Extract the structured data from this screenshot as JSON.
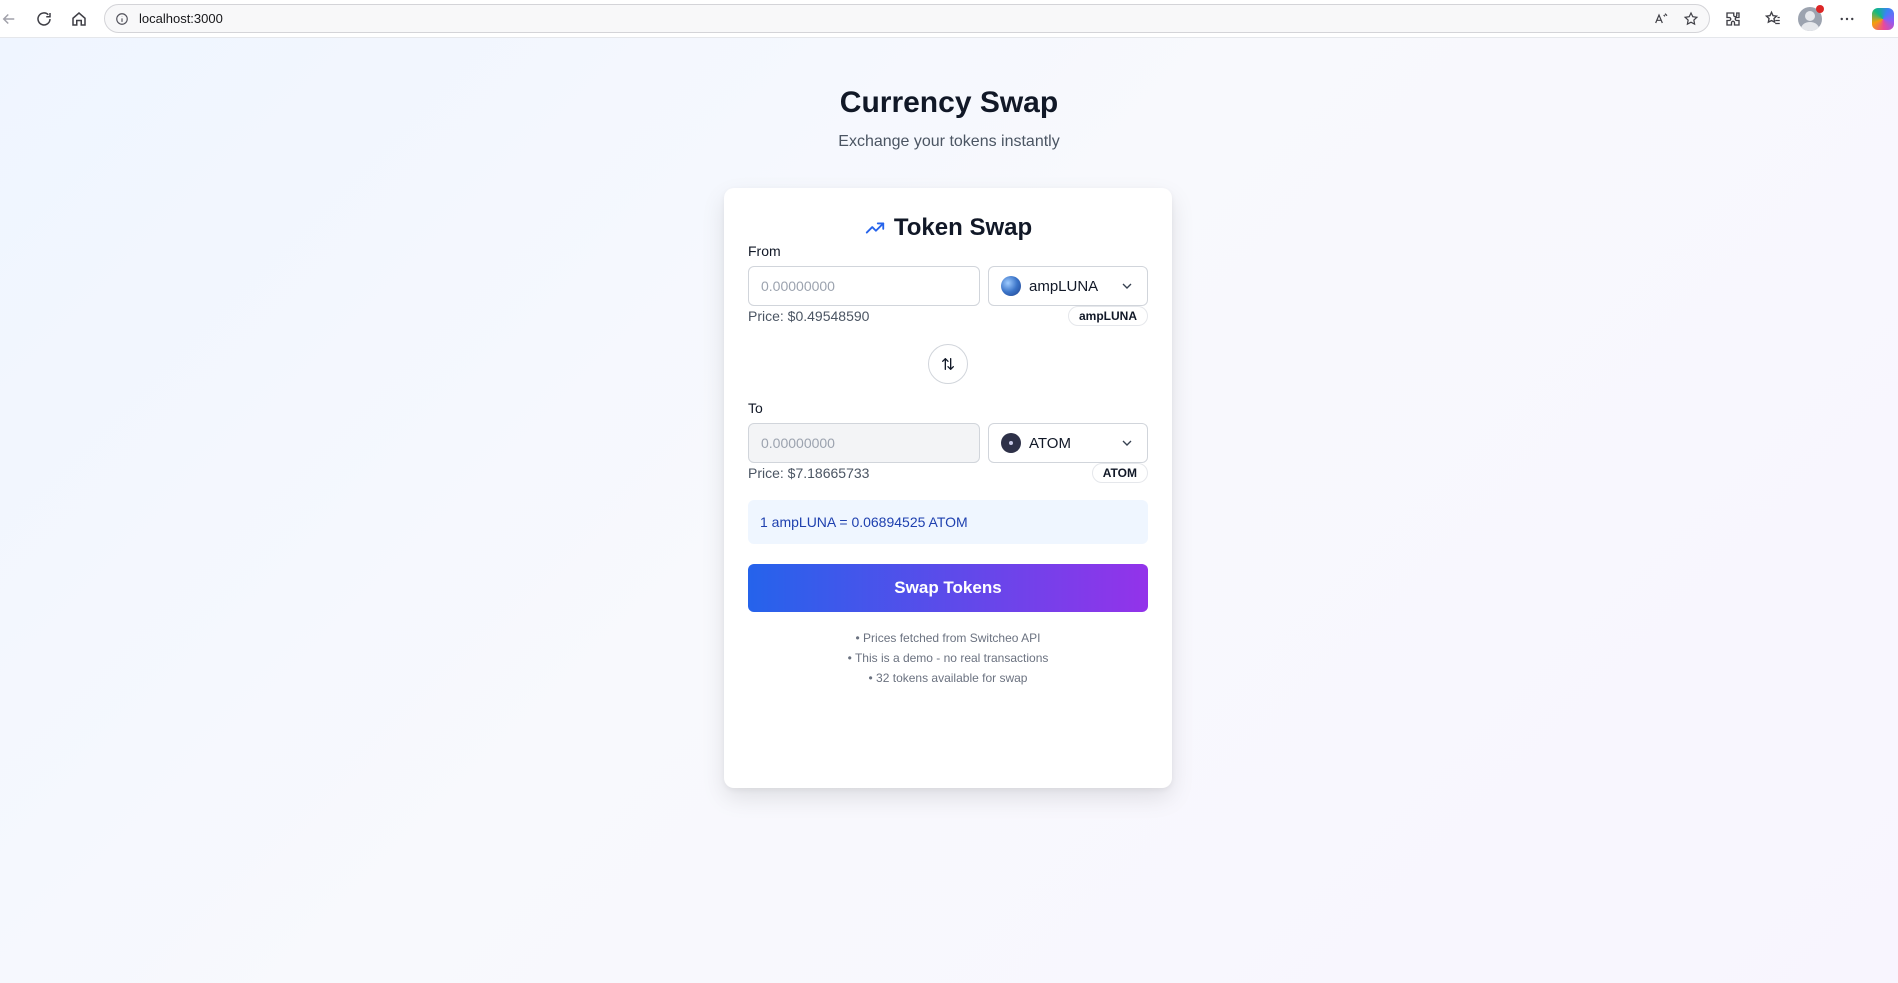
{
  "browser": {
    "url": "localhost:3000"
  },
  "page": {
    "title": "Currency Swap",
    "subtitle": "Exchange your tokens instantly"
  },
  "card": {
    "title": "Token Swap",
    "from": {
      "label": "From",
      "amount_placeholder": "0.00000000",
      "amount_value": "",
      "token": "ampLUNA",
      "price": "Price: $0.49548590",
      "badge": "ampLUNA"
    },
    "to": {
      "label": "To",
      "amount_placeholder": "0.00000000",
      "amount_value": "",
      "token": "ATOM",
      "price": "Price: $7.18665733",
      "badge": "ATOM"
    },
    "rate": "1 ampLUNA = 0.06894525 ATOM",
    "swap_button": "Swap Tokens",
    "notes": [
      "• Prices fetched from Switcheo API",
      "• This is a demo - no real transactions",
      "• 32 tokens available for swap"
    ]
  },
  "colors": {
    "accent": "#2563eb",
    "button_gradient_start": "#2563eb",
    "button_gradient_end": "#9333ea",
    "rate_bg": "#eff6ff",
    "rate_text": "#1e40af"
  },
  "icons": {
    "header": "trending-up-icon",
    "swap": "arrows-up-down-icon",
    "select": "chevron-down-icon"
  }
}
